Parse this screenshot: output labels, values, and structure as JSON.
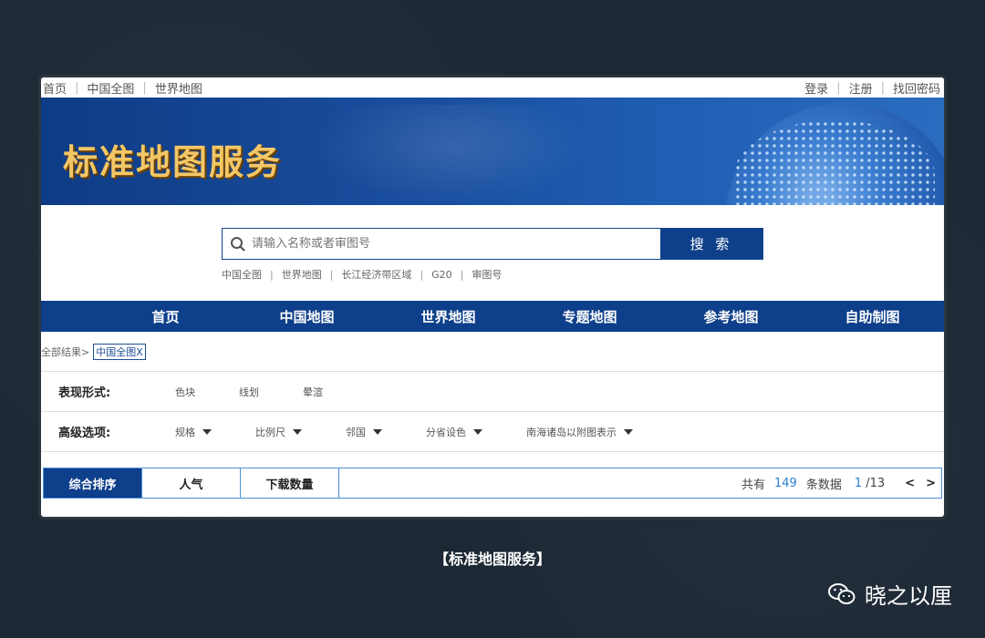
{
  "topbar": {
    "left": [
      "首页",
      "中国全图",
      "世界地图"
    ],
    "right": [
      "登录",
      "注册",
      "找回密码"
    ]
  },
  "banner": {
    "title": "标准地图服务"
  },
  "search": {
    "placeholder": "请输入名称或者审图号",
    "button_label": "搜 索",
    "quick_links": [
      "中国全图",
      "世界地图",
      "长江经济带区域",
      "G20",
      "审图号"
    ]
  },
  "nav": [
    "首页",
    "中国地图",
    "世界地图",
    "专题地图",
    "参考地图",
    "自助制图"
  ],
  "breadcrumb": {
    "prefix": "全部结果>",
    "tag": "中国全图X"
  },
  "filters": {
    "style_label": "表现形式:",
    "style_options": [
      "色块",
      "线划",
      "晕渲"
    ],
    "advanced_label": "高级选项:",
    "advanced_options": [
      "规格",
      "比例尺",
      "邻国",
      "分省设色",
      "南海诸岛以附图表示"
    ]
  },
  "sort": {
    "tabs": [
      "综合排序",
      "人气",
      "下载数量"
    ],
    "total_prefix": "共有",
    "total": "149",
    "total_suffix": "条数据",
    "page_current": "1",
    "page_total": "/13",
    "prev": "<",
    "next": ">"
  },
  "caption": "【标准地图服务】",
  "watermark": "晓之以厘",
  "colors": {
    "primary": "#0e3f8a",
    "accent": "#2a7fd4",
    "logo": "#f3c766"
  }
}
